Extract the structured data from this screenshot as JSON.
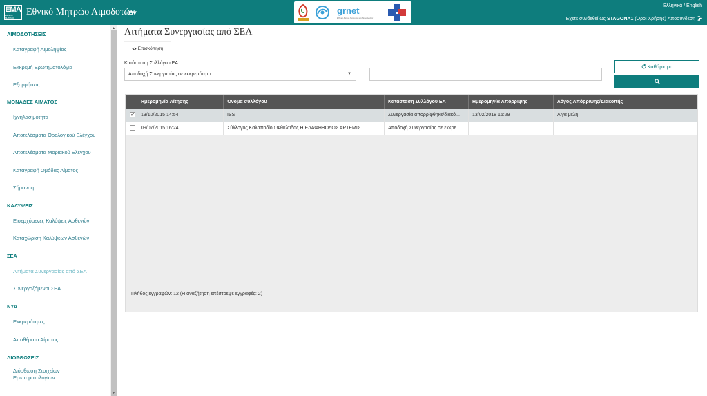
{
  "header": {
    "logo_text": "ΕΜΑ",
    "logo_subtext": "ΕΘΝΙΚΟ ΜΗΤΡΩΟ",
    "title": "Εθνικό Μητρώο Αιμοδοτών",
    "menu_icon": "≡▾",
    "partner_grnet": "grnet",
    "partner_grnet_sub": "Εθνικό Δίκτυο Έρευνας και Τεχνολογίας",
    "lang_greek": "Ελληνικά",
    "lang_sep": " / ",
    "lang_english": "English",
    "user_prefix": "Έχετε συνδεθεί ως ",
    "user_name": "STAGONA1",
    "terms": " (Όροι Χρήσης)",
    "logout": " Αποσύνδεση",
    "colors": {
      "brand": "#0e7d7d"
    }
  },
  "sidebar": {
    "sections": [
      {
        "title": "ΑΙΜΟΔΟΤΗΣΕΙΣ",
        "items": [
          "Καταγραφή Αιμοληψίας",
          "Εκκρεμή Ερωτηματολόγια",
          "Εξορμήσεις"
        ]
      },
      {
        "title": "ΜΟΝΑΔΕΣ ΑΙΜΑΤΟΣ",
        "items": [
          "Ιχνηλασιμότητα",
          "Αποτελέσματα Ορολογικού Ελέγχου",
          "Αποτελέσματα Μοριακού Ελέγχου",
          "Καταγραφή Ομάδας Αίματος",
          "Σήμανση"
        ]
      },
      {
        "title": "ΚΑΛΥΨΕΙΣ",
        "items": [
          "Εισερχόμενες Καλύψεις Ασθενών",
          "Καταχώριση Καλύψεων Ασθενών"
        ]
      },
      {
        "title": "ΣΕΑ",
        "items": [
          "Αιτήματα Συνεργασίας από ΣΕΑ",
          "Συνεργαζόμενοι ΣΕΑ"
        ]
      },
      {
        "title": "ΝΥΑ",
        "items": [
          "Εκκρεμότητες",
          "Αποθέματα Αίματος"
        ]
      },
      {
        "title": "ΔΙΟΡΘΩΣΕΙΣ",
        "items": [
          "Διόρθωση Στοιχείων",
          "Ερωτηματολογίων"
        ]
      }
    ]
  },
  "main": {
    "title": "Αιτήματα Συνεργασίας από ΣΕΑ",
    "tab_overview": "Επισκόπηση",
    "filter_label": "Κατάσταση Συλλόγου ΕΑ",
    "filter_selected": "Αποδοχή Συνεργασίας σε εκκρεμότητα",
    "search_value": "",
    "search_placeholder": "",
    "clear_label": "Καθάρισμα",
    "table": {
      "columns": [
        "Ημερομηνία Αίτησης",
        "Όνομα συλλόγου",
        "Κατάσταση Συλλόγου ΕΑ",
        "Ημερομηνία Απόρριψης",
        "Λόγος Απόρριψης/Διακοπής"
      ],
      "rows": [
        {
          "checked": "✔",
          "date": "13/10/2015 14:54",
          "name": "ISS",
          "status": "Συνεργασία απορρίφθηκε/διακό...",
          "rejection_date": "13/02/2018 15:29",
          "reason": "Λιγα μελη"
        },
        {
          "checked": "",
          "date": "09/07/2015 16:24",
          "name": "Σύλλογος Καλαποδίου Φθιώτιδας Η ΕΛΑΦΗΒΟΛΟΣ ΑΡΤΕΜΙΣ",
          "status": "Αποδοχή Συνεργασίας σε εκκρε...",
          "rejection_date": "",
          "reason": ""
        }
      ],
      "footer": "Πλήθος εγγραφών: 12 (Η αναζήτηση επέστρεψε εγγραφές: 2)"
    }
  }
}
